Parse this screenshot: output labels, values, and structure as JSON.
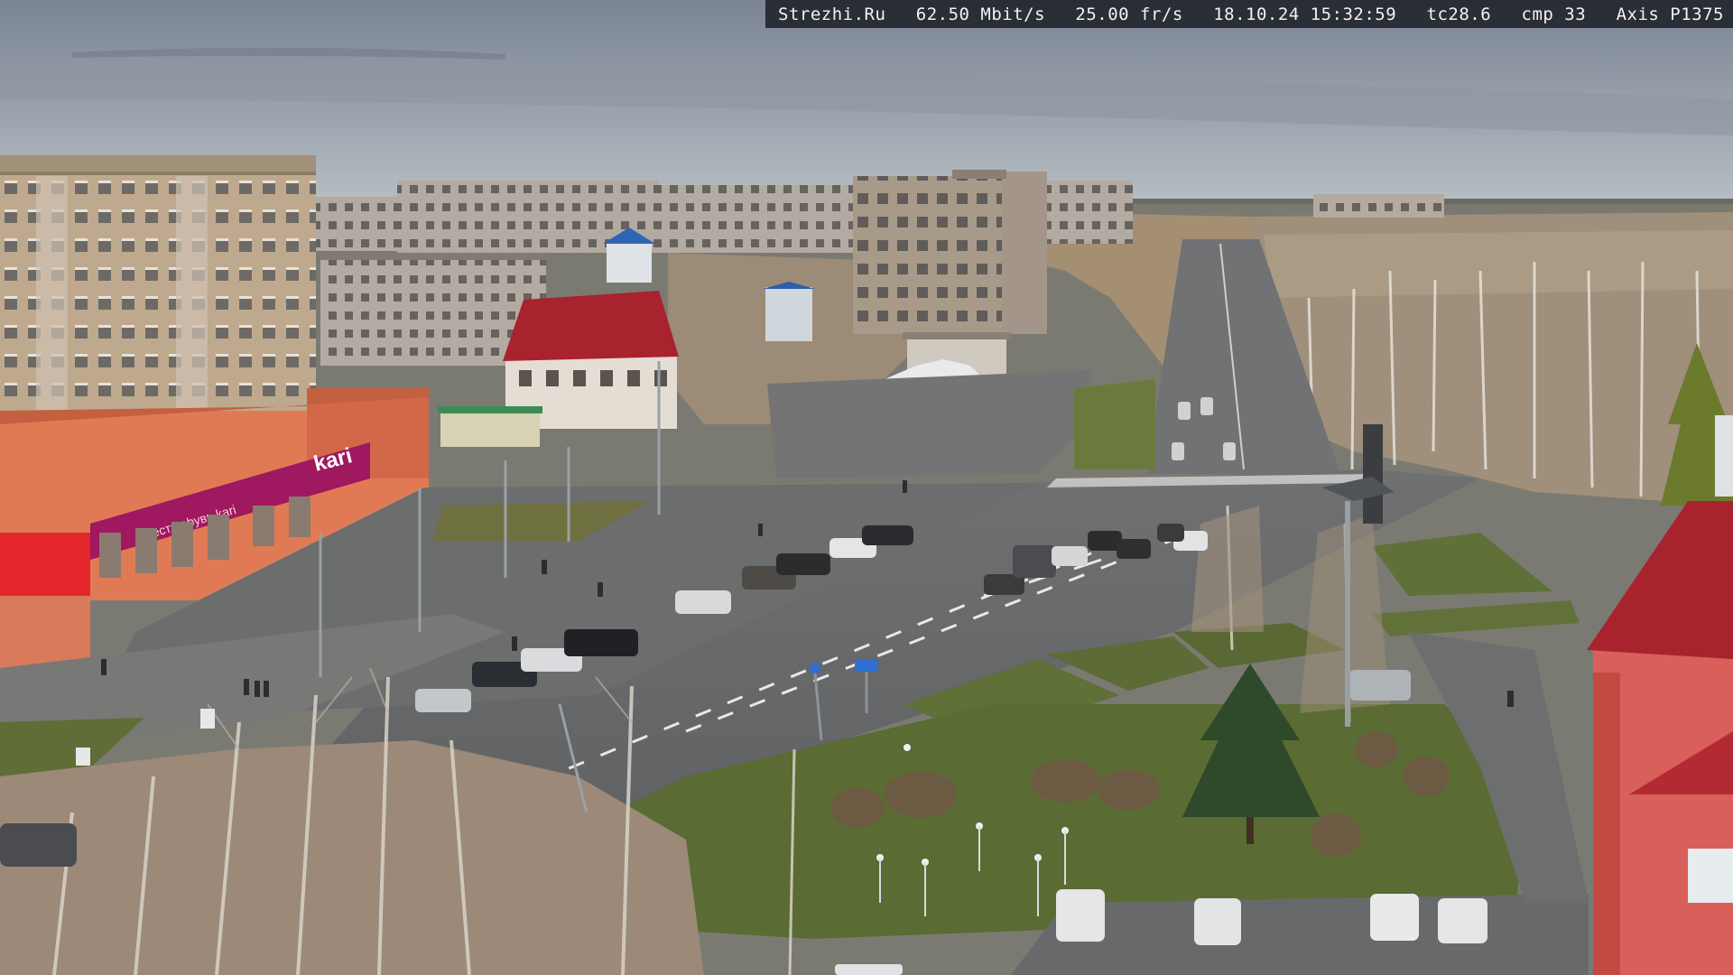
{
  "overlay": {
    "site": "Strezhi.Ru",
    "bitrate": "62.50 Mbit/s",
    "framerate": "25.00 fr/s",
    "datetime": "18.10.24 15:32:59",
    "tc": "tc28.6",
    "cmp": "cmp 33",
    "camera": "Axis P1375"
  },
  "signage": {
    "store_logo": "kari",
    "store_slogan": "есть obувь kari"
  },
  "colors": {
    "sky_top": "#7d8696",
    "sky_horizon": "#b7bfc4",
    "asphalt": "#6c6e70",
    "grass": "#5f7038",
    "store_facade": "#e07a55",
    "store_banner": "#a0185f",
    "apartment_brick": "#bfa98e",
    "red_roof": "#a9232e"
  }
}
